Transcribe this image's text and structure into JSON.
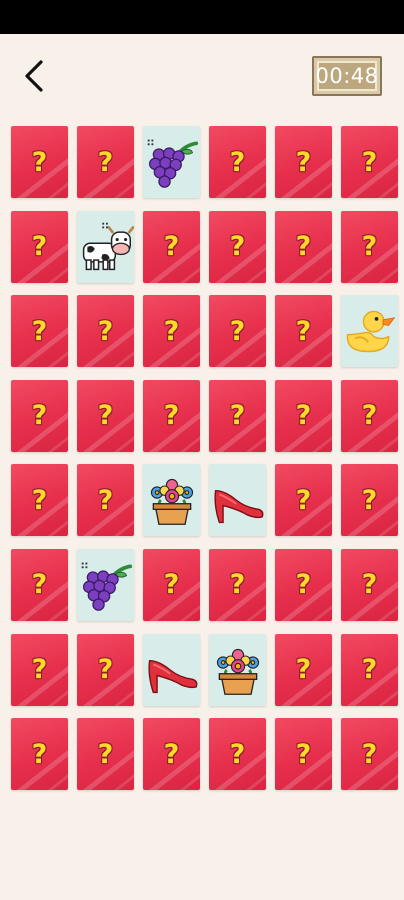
{
  "header": {
    "back_icon": "chevron-left-icon",
    "timer": "00:48"
  },
  "card_back": {
    "symbol": "?",
    "colors": {
      "face": "#e8344f",
      "symbol": "#ffd82a",
      "outline": "#8c1f2c"
    }
  },
  "revealed_color": "#d8ecea",
  "board": {
    "columns": 6,
    "rows": 8,
    "cards": [
      "hidden",
      "hidden",
      "grapes",
      "hidden",
      "hidden",
      "hidden",
      "hidden",
      "cow",
      "hidden",
      "hidden",
      "hidden",
      "hidden",
      "hidden",
      "hidden",
      "hidden",
      "hidden",
      "hidden",
      "duck",
      "hidden",
      "hidden",
      "hidden",
      "hidden",
      "hidden",
      "hidden",
      "hidden",
      "hidden",
      "flower-pot",
      "high-heel",
      "hidden",
      "hidden",
      "hidden",
      "grapes",
      "hidden",
      "hidden",
      "hidden",
      "hidden",
      "hidden",
      "hidden",
      "high-heel",
      "flower-pot",
      "hidden",
      "hidden",
      "hidden",
      "hidden",
      "hidden",
      "hidden",
      "hidden",
      "hidden"
    ]
  }
}
